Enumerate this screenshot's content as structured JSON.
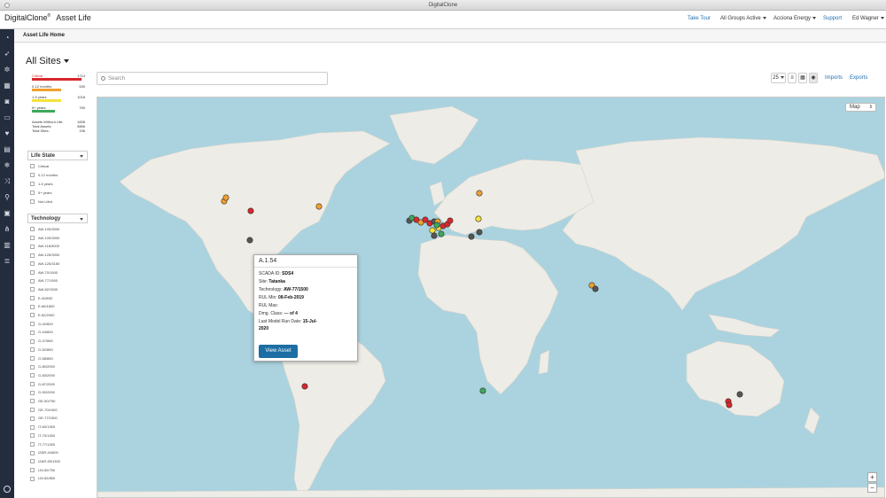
{
  "window": {
    "title": "DigitalClone"
  },
  "topnav": {
    "brand": "DigitalClone",
    "brand_mark": "®",
    "app": "Asset Life",
    "take_tour": "Take Tour",
    "groups": "All Groups Active",
    "org": "Acciona Energy",
    "support": "Support",
    "user": "Ed Wagner"
  },
  "breadcrumb": "Asset Life Home",
  "sites_label": "All Sites",
  "summary": {
    "rows": [
      {
        "label": "Critical",
        "value": "1714",
        "color": "#d9272e"
      },
      {
        "label": "0-12 months",
        "value": "530",
        "color": "#f0a030"
      },
      {
        "label": "1-5 years",
        "value": "1018",
        "color": "#f4e23a"
      },
      {
        "label": "5+ years",
        "value": "769",
        "color": "#3ea85a"
      }
    ],
    "totals": [
      {
        "label": "Assets Without Life:",
        "value": "1835"
      },
      {
        "label": "Total Assets:",
        "value": "5866"
      },
      {
        "label": "Total Sites:",
        "value": "196"
      }
    ]
  },
  "life_state": {
    "title": "Life State",
    "items": [
      "Critical",
      "0-12 months",
      "1-5 years",
      "5+ years",
      "Not Lifed"
    ]
  },
  "technology": {
    "title": "Technology",
    "items": [
      "AW-100/3000",
      "AW-109/3000",
      "AW-116/3000",
      "AW-125/3000",
      "AW-125/3150",
      "AW-70/1500",
      "AW-77/1500",
      "AW-82/1500",
      "E-40/600",
      "E-66/1800",
      "E-82/2000",
      "G-42/600",
      "G-44/600",
      "G-47/660",
      "G-52/850",
      "G-58/850",
      "G-80/2000",
      "G-83/2000",
      "G-87/2000",
      "G-90/2000",
      "GE-50/750",
      "GE-70/1500",
      "GE-77/1500",
      "IT-60/1300",
      "IT-70/1300",
      "IT-77/1300",
      "IZAR-44/600",
      "IZAR-55/1300",
      "LM-50/750",
      "LM-52/850"
    ]
  },
  "search": {
    "placeholder": "Search"
  },
  "controls": {
    "page_size": "25",
    "imports": "Imports",
    "exports": "Exports"
  },
  "map": {
    "type_label": "Map",
    "zoom_in": "+",
    "zoom_out": "−",
    "marker_colors": {
      "critical": "#d9272e",
      "months": "#f0a030",
      "years": "#f4e23a",
      "good": "#3ea85a",
      "unlifed": "#555555"
    }
  },
  "popup": {
    "title": "A.1.54",
    "fields": [
      {
        "label": "SCADA ID:",
        "value": "SDS4"
      },
      {
        "label": "Site:",
        "value": "Tatanka"
      },
      {
        "label": "Technology:",
        "value": "AW-77/1500"
      },
      {
        "label": "RUL Min:",
        "value": "08-Feb-2019"
      },
      {
        "label": "RUL Max:",
        "value": ""
      },
      {
        "label": "Dmg. Class:",
        "value": "--- of 4"
      },
      {
        "label": "Last Model Run Date:",
        "value": "15-Jul-"
      },
      {
        "label": "",
        "value": "2020"
      }
    ],
    "button": "View Asset"
  }
}
